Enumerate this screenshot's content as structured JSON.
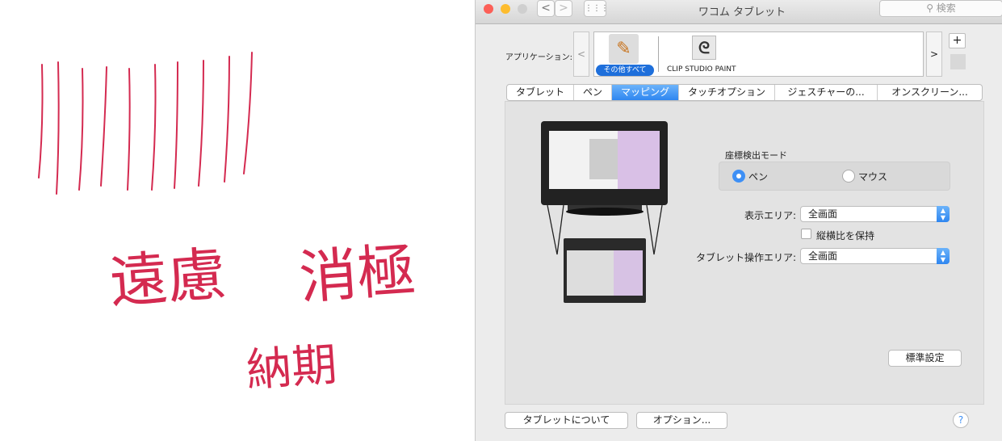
{
  "canvas": {
    "handwriting": [
      "遠慮",
      "消極",
      "納期"
    ],
    "stroke_color": "#d42a50"
  },
  "window": {
    "title": "ワコム タブレット",
    "search_placeholder": "検索",
    "nav": {
      "back": "<",
      "forward": ">",
      "grid": "⋮⋮⋮"
    },
    "applications": {
      "label": "アプリケーション:",
      "prev": "<",
      "next": ">",
      "add": "+",
      "items": [
        {
          "label": "その他すべて",
          "selected": true
        },
        {
          "label": "CLIP STUDIO PAINT",
          "selected": false
        }
      ]
    },
    "tabs": [
      {
        "label": "タブレット"
      },
      {
        "label": "ペン"
      },
      {
        "label": "マッピング",
        "selected": true
      },
      {
        "label": "タッチオプション"
      },
      {
        "label": "ジェスチャーの..."
      },
      {
        "label": "オンスクリーン..."
      }
    ],
    "mapping": {
      "mode_title": "座標検出モード",
      "mode_pen": "ペン",
      "mode_mouse": "マウス",
      "selected_mode": "ペン",
      "display_area_label": "表示エリア:",
      "display_area_value": "全画面",
      "keep_ratio_label": "縦横比を保持",
      "keep_ratio_checked": false,
      "tablet_area_label": "タブレット操作エリア:",
      "tablet_area_value": "全画面",
      "default_button": "標準設定"
    },
    "footer": {
      "about": "タブレットについて",
      "options": "オプション...",
      "help": "?"
    }
  }
}
